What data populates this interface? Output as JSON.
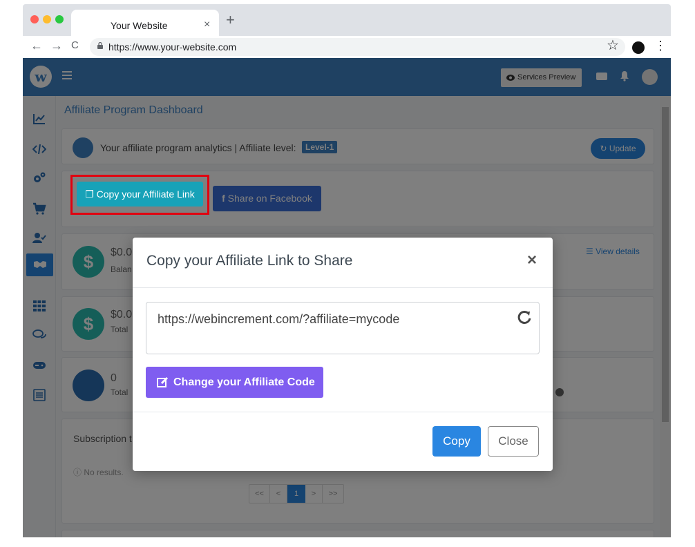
{
  "browser": {
    "tab_title": "Your Website",
    "tab_close": "×",
    "new_tab": "+",
    "url": "https://www.your-website.com",
    "back": "←",
    "forward": "→",
    "reload": "C",
    "star": "☆",
    "menu": "⋮"
  },
  "header": {
    "services_preview": "Services Preview"
  },
  "page": {
    "title": "Affiliate Program Dashboard",
    "analytics_text": "Your affiliate program analytics | Affiliate level:",
    "level_badge": "Level-1",
    "update_label": "Update",
    "copy_link_label": "Copy your Affiliate Link",
    "share_facebook_label": "Share on Facebook",
    "balance_value": "$0.0",
    "balance_label": "Balan",
    "view_details": "View details",
    "total_value": "$0.0",
    "total_label": "Total",
    "count_value": "0",
    "count_label": "Total",
    "subscription_label": "Subscription t",
    "no_results": "No results.",
    "pagination": [
      "<<",
      "<",
      "1",
      ">",
      ">>"
    ]
  },
  "modal": {
    "title": "Copy your Affiliate Link to Share",
    "close_symbol": "×",
    "affiliate_link": "https://webincrement.com/?affiliate=mycode",
    "change_code_label": "Change your Affiliate Code",
    "copy_label": "Copy",
    "close_label": "Close"
  },
  "colors": {
    "brand_blue": "#3f83c4",
    "teal": "#17a2b8",
    "purple": "#7f5df0",
    "copy_blue": "#2a86e1",
    "highlight_red": "#e1000f"
  }
}
